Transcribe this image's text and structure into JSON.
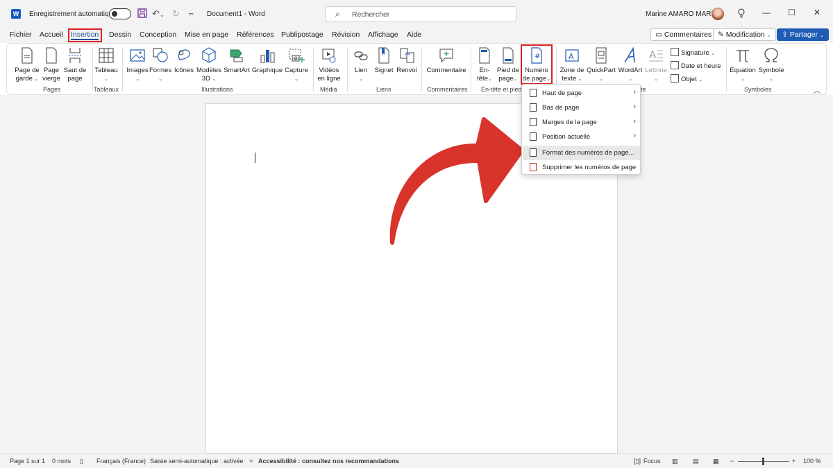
{
  "titlebar": {
    "app_icon": "W",
    "autosave_label": "Enregistrement automatique",
    "document_title": "Document1  -  Word",
    "search_placeholder": "Rechercher",
    "user_name": "Marine AMARO MARIA",
    "minimize": "—",
    "maximize": "☐",
    "close": "✕"
  },
  "tabs": {
    "items": [
      "Fichier",
      "Accueil",
      "Insertion",
      "Dessin",
      "Conception",
      "Mise en page",
      "Références",
      "Publipostage",
      "Révision",
      "Affichage",
      "Aide"
    ],
    "active": "Insertion",
    "comments_button": "Commentaires",
    "editing_button": "Modification",
    "share_button": "Partager"
  },
  "ribbon": {
    "pages": {
      "group_label": "Pages",
      "cover_page": [
        "Page de",
        "garde"
      ],
      "blank_page": [
        "Page",
        "vierge"
      ],
      "page_break": [
        "Saut de",
        "page"
      ]
    },
    "tables": {
      "group_label": "Tableaux",
      "table": "Tableau"
    },
    "illustrations": {
      "group_label": "Illustrations",
      "images": "Images",
      "shapes": "Formes",
      "icons": "Icônes",
      "models": [
        "Modèles",
        "3D"
      ],
      "smartart": "SmartArt",
      "chart": "Graphique",
      "screenshot": "Capture"
    },
    "media": {
      "group_label": "Média",
      "online_video": [
        "Vidéos",
        "en ligne"
      ]
    },
    "links": {
      "group_label": "Liens",
      "link": "Lien",
      "bookmark": "Signet",
      "cross_ref": "Renvoi"
    },
    "comments": {
      "group_label": "Commentaires",
      "comment": "Commentaire"
    },
    "header_footer": {
      "group_label": "En-tête et pied",
      "header": [
        "En-",
        "tête"
      ],
      "footer": [
        "Pied de",
        "page"
      ],
      "page_number": [
        "Numéro",
        "de page"
      ]
    },
    "text": {
      "group_label": "te",
      "text_box": [
        "Zone de",
        "texte"
      ],
      "quickpart": "QuickPart",
      "wordart": "WordArt",
      "dropcap": "Lettrine",
      "signature": "Signature",
      "date_time": "Date et heure",
      "object": "Objet"
    },
    "symbols": {
      "group_label": "Symboles",
      "equation": "Équation",
      "symbol": "Symbole"
    }
  },
  "menu": {
    "items": [
      {
        "label": "Haut de page",
        "submenu": true
      },
      {
        "label": "Bas de page",
        "submenu": true
      },
      {
        "label": "Marges de la page",
        "submenu": true
      },
      {
        "label": "Position actuelle",
        "submenu": true
      },
      {
        "label": "Format des numéros de page...",
        "submenu": false,
        "hovered": true
      },
      {
        "label": "Supprimer les numéros de page",
        "submenu": false
      }
    ]
  },
  "statusbar": {
    "page": "Page 1 sur 1",
    "words": "0 mots",
    "language": "Français (France)",
    "predictive": "Saisie semi-automatique : activée",
    "accessibility": "Accessibilité : consultez nos recommandations",
    "focus": "Focus",
    "zoom_minus": "−",
    "zoom_plus": "+",
    "zoom": "100 %"
  },
  "colors": {
    "accent": "#1f5cb5",
    "highlight_box": "#e02020",
    "annotation_arrow": "#d9342b"
  }
}
